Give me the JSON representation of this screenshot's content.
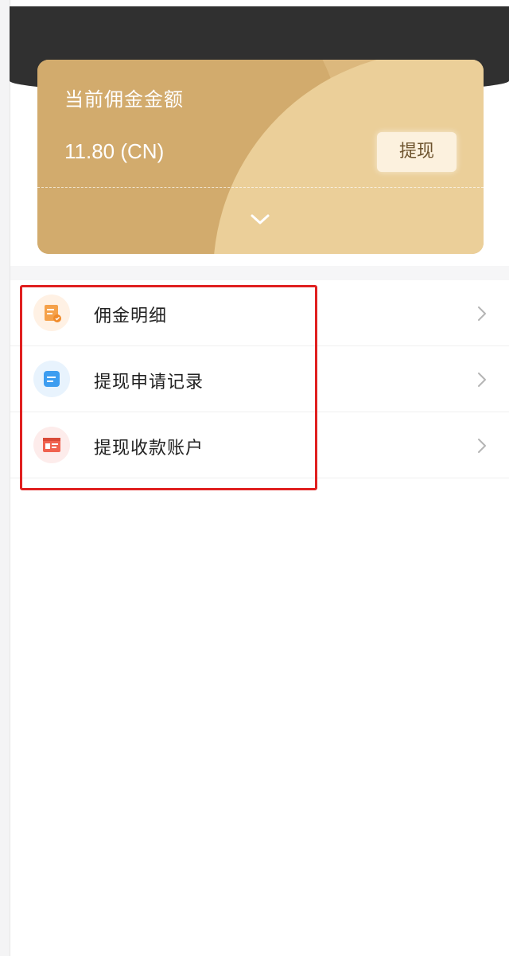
{
  "card": {
    "title": "当前佣金金额",
    "amount": "11.80 (CN)",
    "withdraw_label": "提现",
    "expand_icon": "chevron-down-icon"
  },
  "menu": {
    "items": [
      {
        "label": "佣金明细",
        "icon": "commission-detail-icon",
        "icon_color": "#f5a14a",
        "icon_bg": "#fff1e4"
      },
      {
        "label": "提现申请记录",
        "icon": "withdraw-record-icon",
        "icon_color": "#3d9df0",
        "icon_bg": "#e8f3fd"
      },
      {
        "label": "提现收款账户",
        "icon": "payee-account-icon",
        "icon_color": "#f0624f",
        "icon_bg": "#fdeceb"
      }
    ]
  },
  "colors": {
    "header_dark": "#303030",
    "card_gold": "#dcb87d",
    "highlight_red": "#e02020"
  }
}
